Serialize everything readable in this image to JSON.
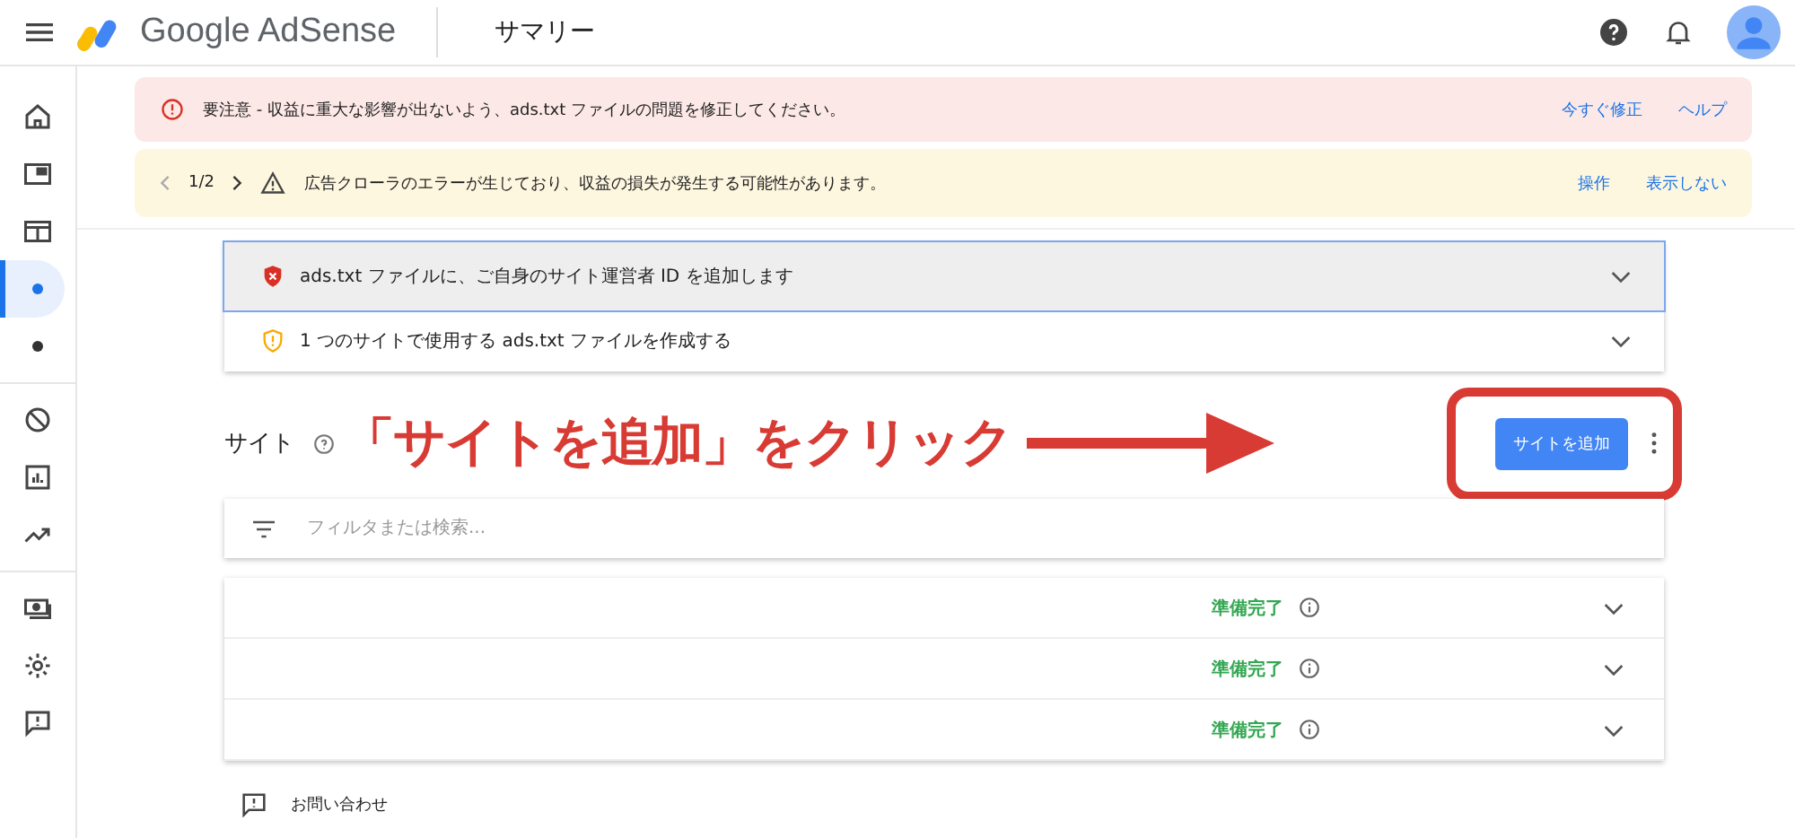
{
  "header": {
    "brand": "Google AdSense",
    "page_title": "サマリー"
  },
  "sidebar": {
    "groups": [
      {
        "items": [
          {
            "selected": false
          },
          {
            "selected": false
          },
          {
            "selected": false
          },
          {
            "selected": true
          },
          {
            "selected": false
          }
        ]
      },
      {
        "items": [
          {
            "selected": false
          },
          {
            "selected": false
          },
          {
            "selected": false
          }
        ]
      },
      {
        "items": [
          {
            "selected": false
          },
          {
            "selected": false
          },
          {
            "selected": false
          }
        ]
      }
    ]
  },
  "alerts": [
    {
      "kind": "error",
      "text": "要注意 - 収益に重大な影響が出ないよう、ads.txt ファイルの問題を修正してください。",
      "actions": [
        "今すぐ修正",
        "ヘルプ"
      ]
    },
    {
      "kind": "warning",
      "pager": "1/2",
      "text": "広告クローラのエラーが生じており、収益の損失が発生する可能性があります。",
      "actions": [
        "操作",
        "表示しない"
      ]
    }
  ],
  "checklist": [
    {
      "kind": "error",
      "text": "ads.txt ファイルに、ご自身のサイト運営者 ID を追加します",
      "selected": true
    },
    {
      "kind": "warning",
      "text": "1 つのサイトで使用する ads.txt ファイルを作成する",
      "selected": false
    }
  ],
  "sites": {
    "title": "サイト",
    "add_button": "サイトを追加",
    "filter_placeholder": "フィルタまたは検索...",
    "rows": [
      {
        "status": "準備完了"
      },
      {
        "status": "準備完了"
      },
      {
        "status": "準備完了"
      }
    ]
  },
  "annotation": {
    "text": "「サイトを追加」をクリック"
  },
  "footer": {
    "contact": "お問い合わせ"
  }
}
